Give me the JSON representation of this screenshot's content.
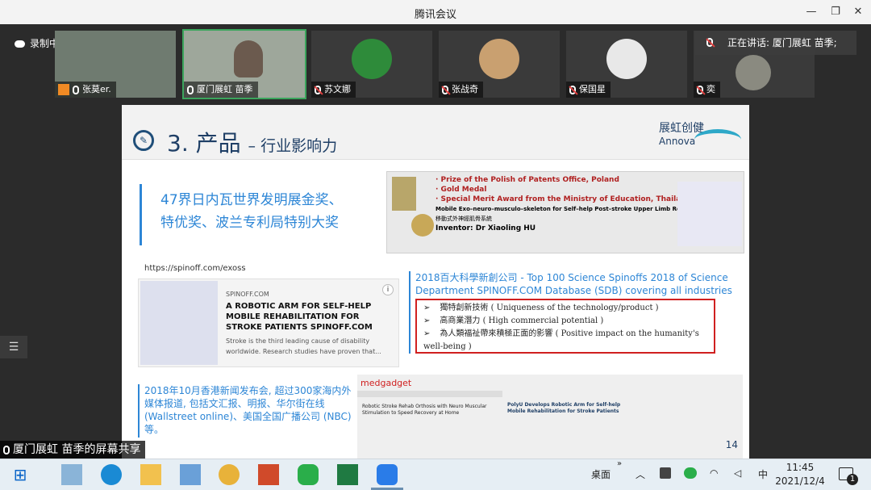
{
  "window": {
    "title": "腾讯会议",
    "minimize": "—",
    "restore": "❐",
    "close": "✕"
  },
  "recording": {
    "label": "录制中"
  },
  "participants": [
    {
      "name": "张莫er.",
      "mic": "on"
    },
    {
      "name": "厦门展虹 苗季",
      "mic": "on"
    },
    {
      "name": "苏文娜",
      "mic": "muted"
    },
    {
      "name": "张战奇",
      "mic": "muted"
    },
    {
      "name": "保国星",
      "mic": "muted"
    },
    {
      "name": "奕",
      "mic": "muted"
    }
  ],
  "speaking": {
    "label": "正在讲话: 厦门展虹 苗季;"
  },
  "share": {
    "label": "厦门展虹 苗季的屏幕共享"
  },
  "slide": {
    "title": "3. 产品",
    "subtitle": "– 行业影响力",
    "brand_cn": "展虹创健",
    "brand_en": "Annova",
    "awards_line1": "47界日内瓦世界发明展金奖、",
    "awards_line2": "特优奖、波兰专利局特别大奖",
    "award_box": {
      "line1": "· Prize of the Polish of Patents Office, Poland",
      "line2": "· Gold Medal",
      "line3": "· Special Merit Award from the Ministry of Education, Thailand",
      "line4": "Mobile Exo–neuro–musculo–skeleton for Self–help Post–stroke Upper Limb Rehabilitation",
      "line5": "移動式外神經肌骨系統",
      "line6": "Inventor: Dr Xiaoling HU"
    },
    "spinoff_url": "https://spinoff.com/exoss",
    "spinoff_source": "SPINOFF.COM",
    "spinoff_headline": "A ROBOTIC ARM FOR SELF-HELP MOBILE REHABILITATION FOR STROKE PATIENTS SPINOFF.COM",
    "spinoff_desc": "Stroke is the third leading cause of disability worldwide. Research studies have proven that...",
    "spinoff_info": "i",
    "top100": "2018百大科學新創公司 - Top 100 Science Spinoffs 2018 of Science Department SPINOFF.COM Database (SDB) covering all industries",
    "bullets": [
      "獨特創新技術 ( Uniqueness of the technology/product )",
      "高商業潛力 ( High commercial potential )",
      "為人類福祉帶來積極正面的影響 ( Positive impact on the humanity's well-being )"
    ],
    "bullet_mark": "➢",
    "news_text": "2018年10月香港新闻发布会, 超过300家海内外媒体报道, 包括文汇报、明报、华尔街在线 (Wallstreet online)、美国全国广播公司 (NBC) 等。",
    "collage": {
      "medgadget": "medgadget",
      "article": "Robotic Stroke Rehab Orthosis with Neuro Muscular Stimulation to Speed Recovery at Home",
      "polyu": "PolyU Develops Robotic Arm for Self-help Mobile Rehabilitation for Stroke Patients",
      "page": "14"
    }
  },
  "taskbar": {
    "start": "⊞",
    "desktop_label": "桌面",
    "chevron": "»",
    "ime": "中",
    "time": "11:45",
    "date": "2021/12/4",
    "notif_count": "1"
  }
}
